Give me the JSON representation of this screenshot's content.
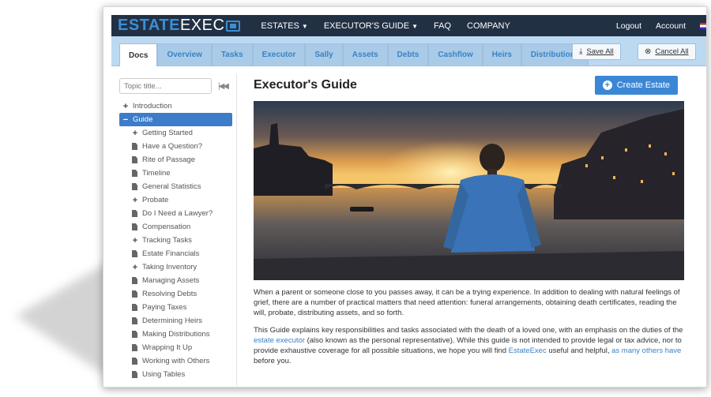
{
  "brand": {
    "part1": "ESTATE",
    "part2": "EXEC"
  },
  "nav": {
    "items": [
      {
        "label": "ESTATES",
        "dropdown": true
      },
      {
        "label": "EXECUTOR'S GUIDE",
        "dropdown": true
      },
      {
        "label": "FAQ",
        "dropdown": false
      },
      {
        "label": "COMPANY",
        "dropdown": false
      }
    ],
    "logout": "Logout",
    "account": "Account"
  },
  "tabs": [
    "Docs",
    "Overview",
    "Tasks",
    "Executor",
    "Sally",
    "Assets",
    "Debts",
    "Cashflow",
    "Heirs",
    "Distributions"
  ],
  "active_tab": "Docs",
  "toolbar": {
    "save_all": "Save All",
    "cancel_all": "Cancel All"
  },
  "sidebar": {
    "search_placeholder": "Topic title...",
    "tree": [
      {
        "label": "Introduction",
        "level": 0,
        "type": "expand"
      },
      {
        "label": "Guide",
        "level": 0,
        "type": "collapse",
        "selected": true
      },
      {
        "label": "Getting Started",
        "level": 1,
        "type": "expand"
      },
      {
        "label": "Have a Question?",
        "level": 1,
        "type": "doc"
      },
      {
        "label": "Rite of Passage",
        "level": 1,
        "type": "doc"
      },
      {
        "label": "Timeline",
        "level": 1,
        "type": "doc"
      },
      {
        "label": "General Statistics",
        "level": 1,
        "type": "doc"
      },
      {
        "label": "Probate",
        "level": 1,
        "type": "expand"
      },
      {
        "label": "Do I Need a Lawyer?",
        "level": 1,
        "type": "doc"
      },
      {
        "label": "Compensation",
        "level": 1,
        "type": "doc"
      },
      {
        "label": "Tracking Tasks",
        "level": 1,
        "type": "expand"
      },
      {
        "label": "Estate Financials",
        "level": 1,
        "type": "doc"
      },
      {
        "label": "Taking Inventory",
        "level": 1,
        "type": "expand"
      },
      {
        "label": "Managing Assets",
        "level": 1,
        "type": "doc"
      },
      {
        "label": "Resolving Debts",
        "level": 1,
        "type": "doc"
      },
      {
        "label": "Paying Taxes",
        "level": 1,
        "type": "doc"
      },
      {
        "label": "Determining Heirs",
        "level": 1,
        "type": "doc"
      },
      {
        "label": "Making Distributions",
        "level": 1,
        "type": "doc"
      },
      {
        "label": "Wrapping It Up",
        "level": 1,
        "type": "doc"
      },
      {
        "label": "Working with Others",
        "level": 1,
        "type": "doc"
      },
      {
        "label": "Using Tables",
        "level": 1,
        "type": "doc"
      }
    ]
  },
  "main": {
    "title": "Executor's Guide",
    "create_button": "Create Estate",
    "para1": "When a parent or someone close to you passes away, it can be a trying experience. In addition to dealing with natural feelings of grief, there are a number of practical matters that need attention: funeral arrangements, obtaining death certificates, reading the will, probate, distributing assets, and so forth.",
    "para2_a": "This Guide explains key responsibilities and tasks associated with the death of a loved one, with an emphasis on the duties of the ",
    "para2_link1": "estate executor",
    "para2_b": " (also known as the personal representative). While this guide is not intended to provide legal or tax advice, nor to provide exhaustive coverage for all possible situations, we hope you will find ",
    "para2_link2": "EstateExec",
    "para2_c": " useful and helpful, ",
    "para2_link3": "as many others have",
    "para2_d": " before you."
  },
  "colors": {
    "nav_bg": "#223044",
    "brand_blue": "#3b8fd6",
    "tab_bar": "#bcd9f2",
    "selected": "#3d7cc9",
    "create_btn": "#3b87d6"
  }
}
